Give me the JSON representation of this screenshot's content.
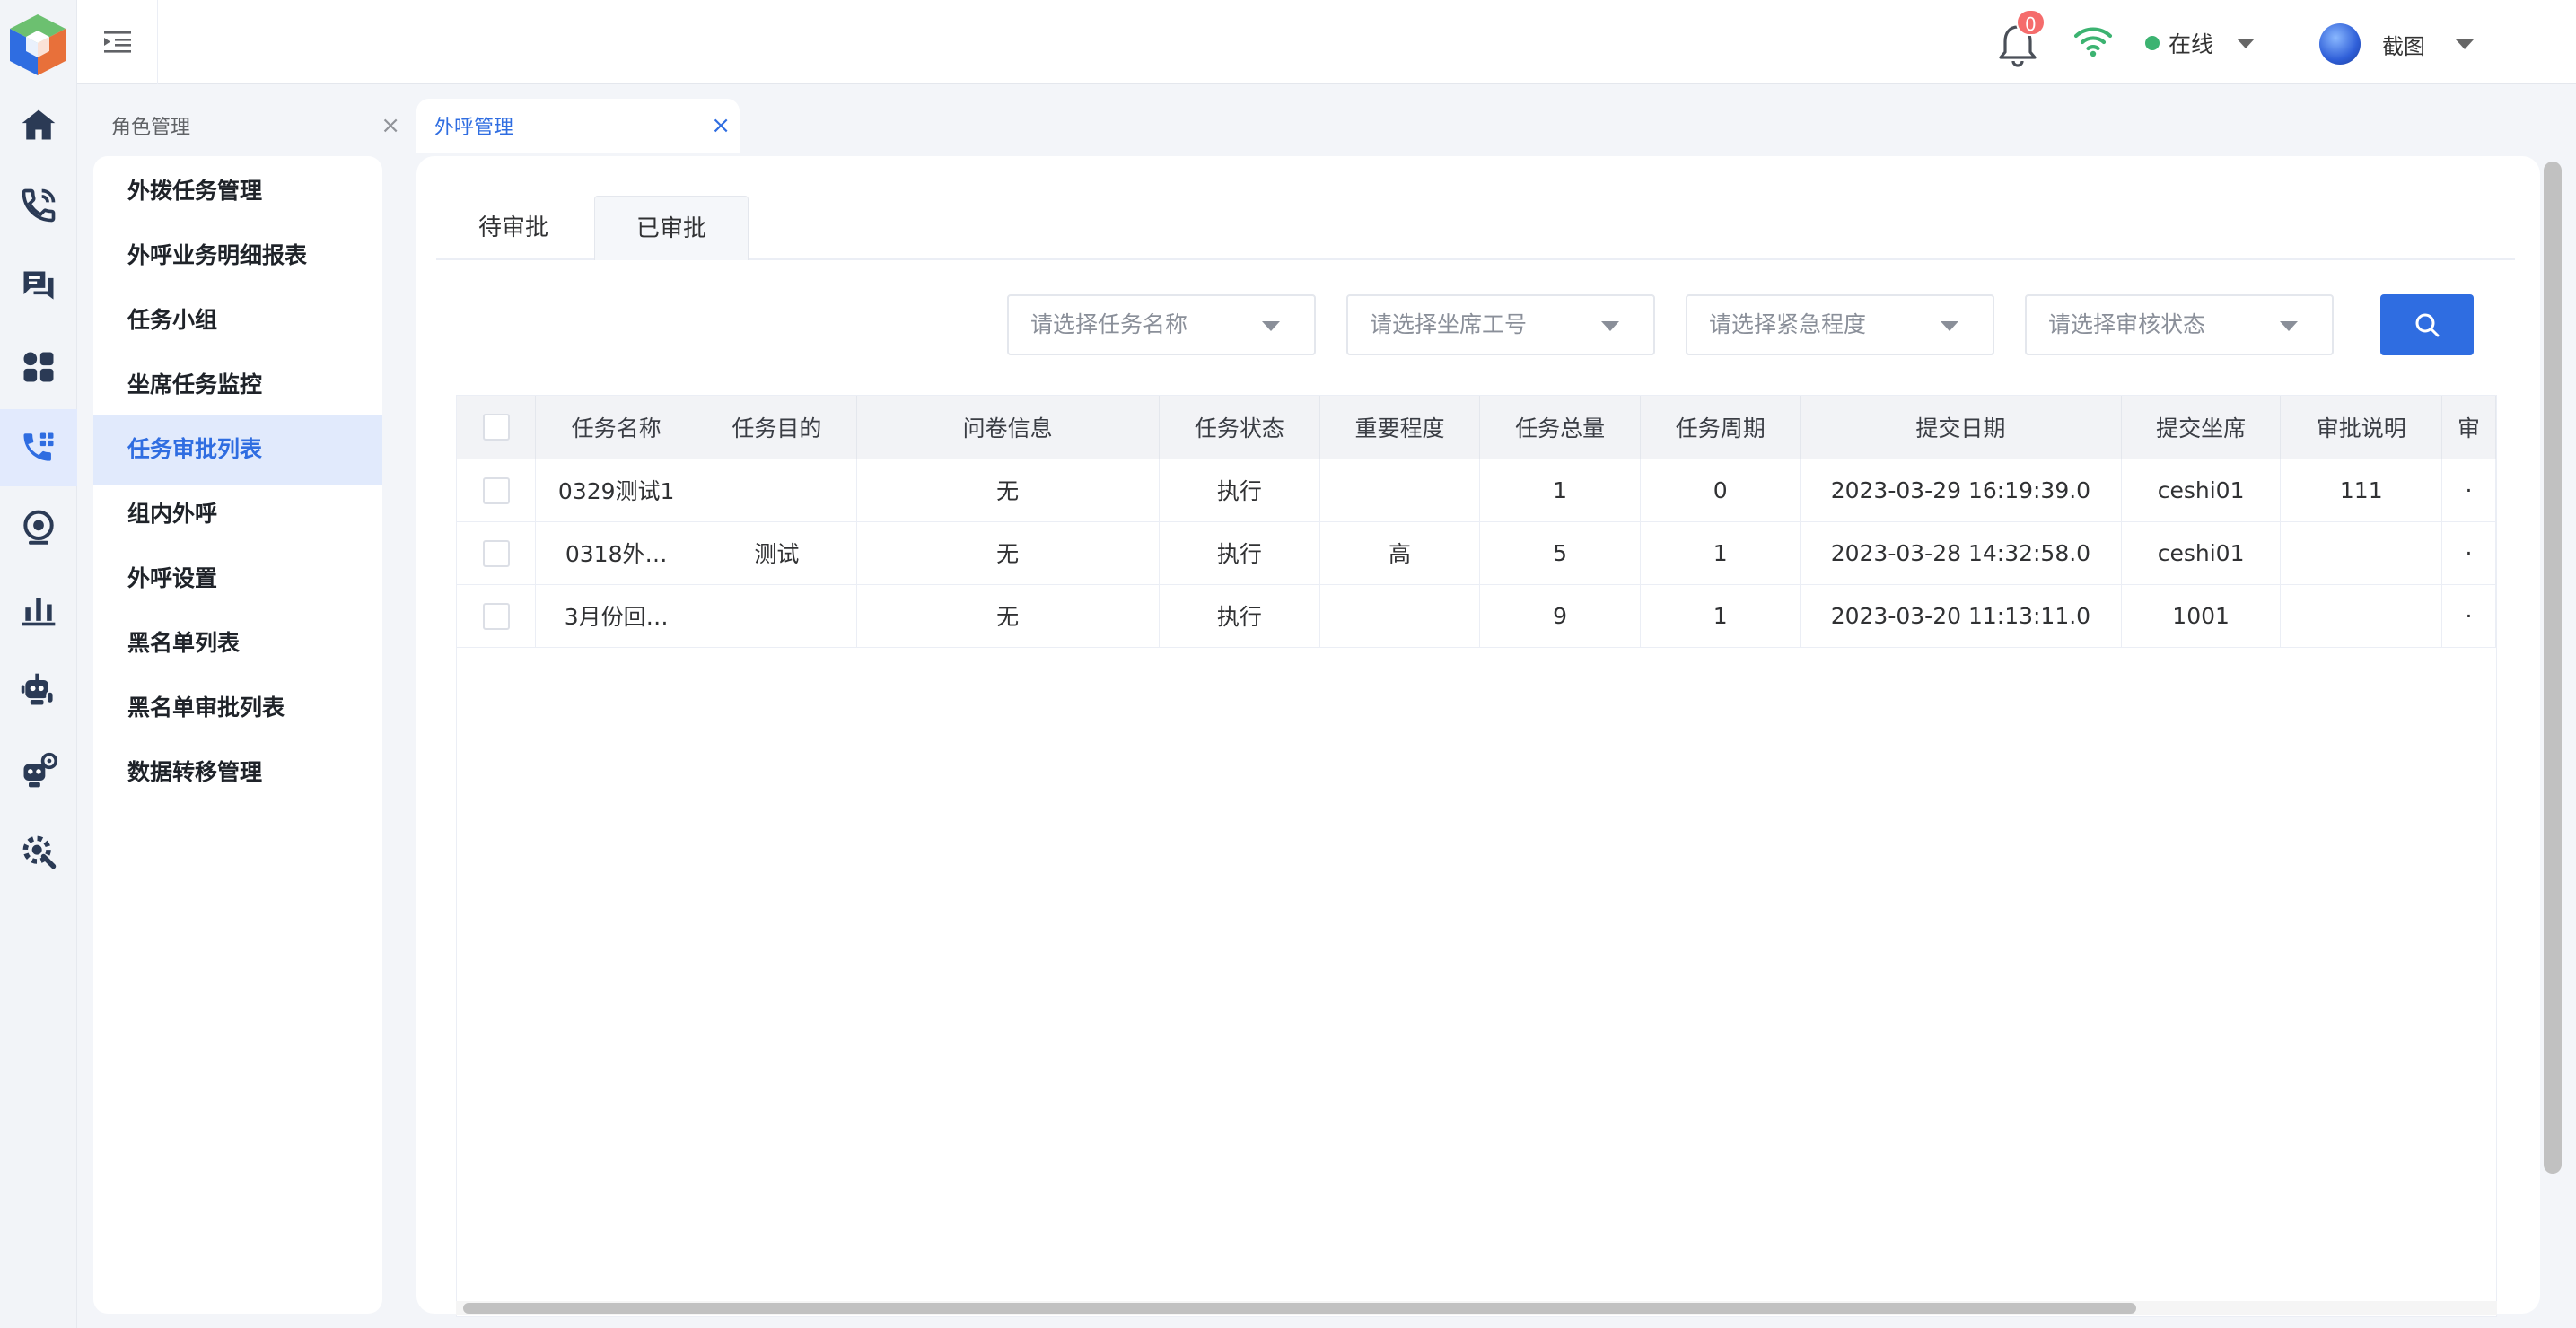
{
  "colors": {
    "accent": "#2f6de1",
    "active_bg": "#e1eafc",
    "online": "#3cb371",
    "badge": "#f56c6c"
  },
  "rail": {
    "logo": "app-logo",
    "items": [
      {
        "icon": "home-icon"
      },
      {
        "icon": "phone-call-icon"
      },
      {
        "icon": "chat-icon"
      },
      {
        "icon": "apps-grid-icon"
      },
      {
        "icon": "phone-grid-icon",
        "active": true
      },
      {
        "icon": "webcam-icon"
      },
      {
        "icon": "bar-chart-icon"
      },
      {
        "icon": "robot-mic-icon"
      },
      {
        "icon": "robot-settings-icon"
      },
      {
        "icon": "tools-gear-icon"
      }
    ]
  },
  "header": {
    "notification_count": "0",
    "status_label": "在线",
    "user_name": "截图"
  },
  "tabs": [
    {
      "label": "角色管理"
    },
    {
      "label": "外呼管理",
      "active": true
    }
  ],
  "submenu": {
    "items": [
      {
        "label": "外拨任务管理"
      },
      {
        "label": "外呼业务明细报表"
      },
      {
        "label": "任务小组"
      },
      {
        "label": "坐席任务监控"
      },
      {
        "label": "任务审批列表",
        "active": true
      },
      {
        "label": "组内外呼"
      },
      {
        "label": "外呼设置"
      },
      {
        "label": "黑名单列表"
      },
      {
        "label": "黑名单审批列表"
      },
      {
        "label": "数据转移管理"
      }
    ]
  },
  "subtabs": [
    {
      "label": "待审批"
    },
    {
      "label": "已审批",
      "active": true
    }
  ],
  "filters": {
    "task_name_placeholder": "请选择任务名称",
    "agent_id_placeholder": "请选择坐席工号",
    "urgency_placeholder": "请选择紧急程度",
    "review_status_placeholder": "请选择审核状态"
  },
  "table": {
    "columns": [
      "任务名称",
      "任务目的",
      "问卷信息",
      "任务状态",
      "重要程度",
      "任务总量",
      "任务周期",
      "提交日期",
      "提交坐席",
      "审批说明",
      "审"
    ],
    "rows": [
      [
        "0329测试1",
        "",
        "无",
        "执行",
        "",
        "1",
        "0",
        "2023-03-29 16:19:39.0",
        "ceshi01",
        "111",
        "·"
      ],
      [
        "0318外…",
        "测试",
        "无",
        "执行",
        "高",
        "5",
        "1",
        "2023-03-28 14:32:58.0",
        "ceshi01",
        "",
        "·"
      ],
      [
        "3月份回…",
        "",
        "无",
        "执行",
        "",
        "9",
        "1",
        "2023-03-20 11:13:11.0",
        "1001",
        "",
        "·"
      ]
    ]
  }
}
